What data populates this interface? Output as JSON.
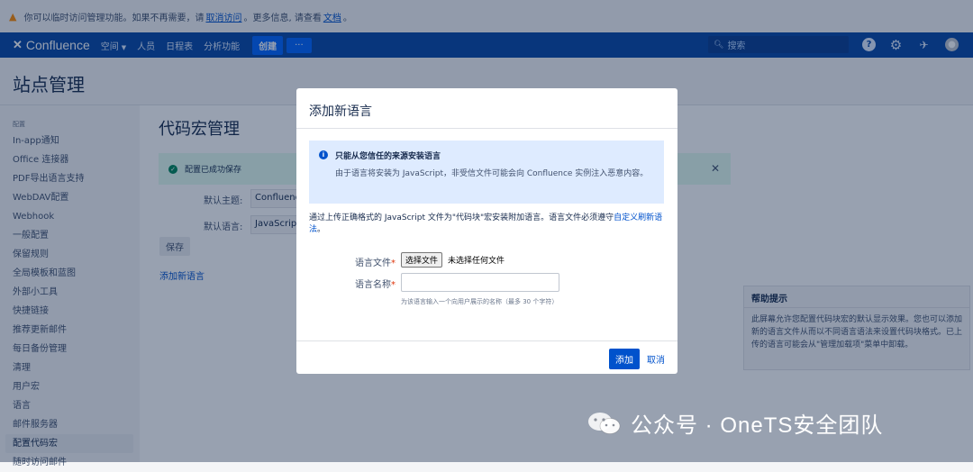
{
  "banner": {
    "text_before": "你可以临时访问管理功能。如果不再需要，请",
    "revoke_link": "取消访问",
    "text_middle": "。更多信息, 请查看",
    "docs_link": "文档",
    "text_after": "。"
  },
  "topnav": {
    "logo": "Confluence",
    "spaces": "空间",
    "people": "人员",
    "calendar": "日程表",
    "analytics": "分析功能",
    "create": "创建",
    "more": "···",
    "search_placeholder": "搜索"
  },
  "page": {
    "title": "站点管理"
  },
  "sidebar": {
    "section": "配置",
    "items": [
      {
        "label": "In-app通知"
      },
      {
        "label": "Office 连接器"
      },
      {
        "label": "PDF导出语言支持"
      },
      {
        "label": "WebDAV配置"
      },
      {
        "label": "Webhook"
      },
      {
        "label": "一般配置"
      },
      {
        "label": "保留规则"
      },
      {
        "label": "全局模板和蓝图"
      },
      {
        "label": "外部小工具"
      },
      {
        "label": "快捷链接"
      },
      {
        "label": "推荐更新邮件"
      },
      {
        "label": "每日备份管理"
      },
      {
        "label": "清理"
      },
      {
        "label": "用户宏"
      },
      {
        "label": "语言"
      },
      {
        "label": "邮件服务器"
      },
      {
        "label": "配置代码宏"
      },
      {
        "label": "随时访问邮件"
      }
    ],
    "active_index": 16
  },
  "main": {
    "title": "代码宏管理",
    "success_msg": "配置已成功保存",
    "default_theme_label": "默认主题:",
    "default_theme_value": "Confluence",
    "default_language_label": "默认语言:",
    "default_language_value": "JavaScript",
    "save_button": "保存",
    "add_language_link": "添加新语言"
  },
  "help": {
    "title": "帮助提示",
    "body": "此屏幕允许您配置代码块宏的默认显示效果。您也可以添加新的语言文件从而以不同语言语法来设置代码块格式。已上传的语言可能会从\"管理加载项\"菜单中卸载。"
  },
  "dialog": {
    "title": "添加新语言",
    "info_title": "只能从您信任的来源安装语言",
    "info_body": "由于语言将安装为 JavaScript，非受信文件可能会向 Confluence 实例注入恶意内容。",
    "desc_text": "通过上传正确格式的 JavaScript 文件为\"代码块\"宏安装附加语言。语言文件必须遵守",
    "desc_link": "自定义刷新语法",
    "desc_end": "。",
    "file_label": "语言文件",
    "file_button": "选择文件",
    "file_status": "未选择任何文件",
    "name_label": "语言名称",
    "name_value": "",
    "hint": "为该语言输入一个向用户展示的名称（最多 30 个字符）",
    "add_button": "添加",
    "cancel_link": "取消"
  },
  "watermark": {
    "text": "公众号 · OneTS安全团队"
  },
  "colors": {
    "nav": "#0747a6",
    "primary": "#0052cc",
    "success_bg": "#e3fcef",
    "info_bg": "#deebff"
  },
  "icons": [
    "warning-icon",
    "confluence-logo-icon",
    "search-icon",
    "help-icon",
    "settings-icon",
    "notifications-icon",
    "avatar-icon",
    "success-icon",
    "close-icon",
    "info-icon",
    "wechat-icon"
  ]
}
